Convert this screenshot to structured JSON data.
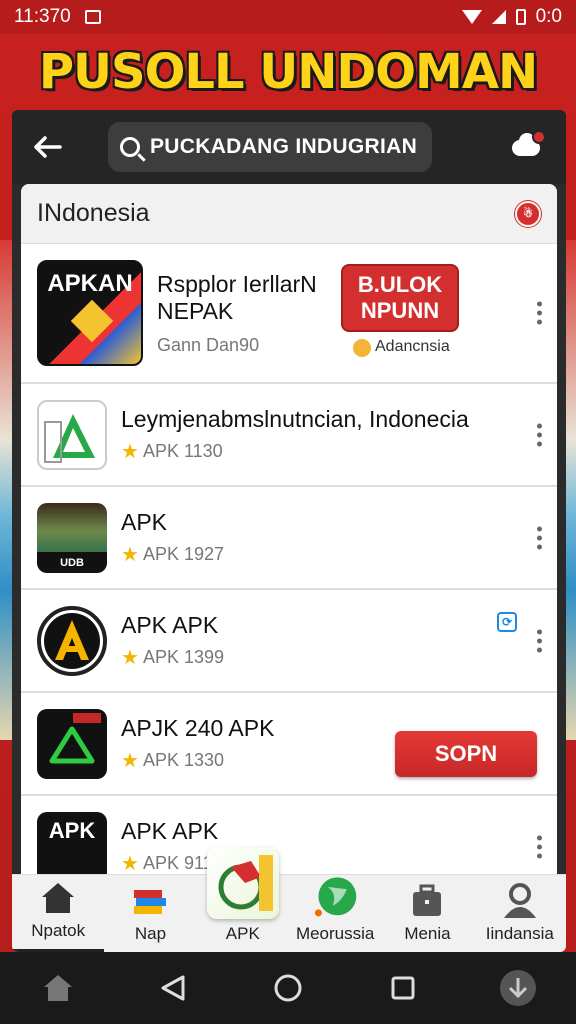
{
  "status_bar": {
    "time": "11:370",
    "battery": "0:0"
  },
  "banner": {
    "title": "PUSOLL UNDOMAN"
  },
  "app_bar": {
    "search_text": "PUCKADANG INDUGRIAN"
  },
  "list": {
    "header_title": "INdonesia",
    "header_badge": "☃",
    "items": [
      {
        "name_line1": "Rspplor IerllarN",
        "name_line2": "NEPAK",
        "meta": "Gann Dan90",
        "icon_text": "APKAN",
        "promo_text_1": "B.ULOK",
        "promo_text_2": "NPUNN",
        "promo_sub": "Adancnsia"
      },
      {
        "name": "Leymjenabmslnutncian, Indonecia",
        "meta": "APK 1130"
      },
      {
        "name": "APK",
        "meta": "APK 1927",
        "icon_text": "UDB"
      },
      {
        "name": "APK APK",
        "meta": "APK 1399"
      },
      {
        "name": "APJK 240 APK",
        "meta": "APK 1330",
        "action": "SOPN"
      },
      {
        "name": "APK APK",
        "meta": "APK 911",
        "icon_text": "APK"
      }
    ]
  },
  "bottom_nav": [
    {
      "label": "Npatok",
      "icon": "home-icon"
    },
    {
      "label": "Nap",
      "icon": "books-icon"
    },
    {
      "label": "APK",
      "icon": "apk-logo-icon"
    },
    {
      "label": "Meorussia",
      "icon": "globe-icon"
    },
    {
      "label": "Menia",
      "icon": "briefcase-icon"
    },
    {
      "label": "Iindansia",
      "icon": "person-icon"
    }
  ],
  "colors": {
    "brand_red": "#c8211f",
    "accent_yellow": "#ffd21a",
    "button_red": "#d32f2f",
    "star": "#f4b400"
  }
}
